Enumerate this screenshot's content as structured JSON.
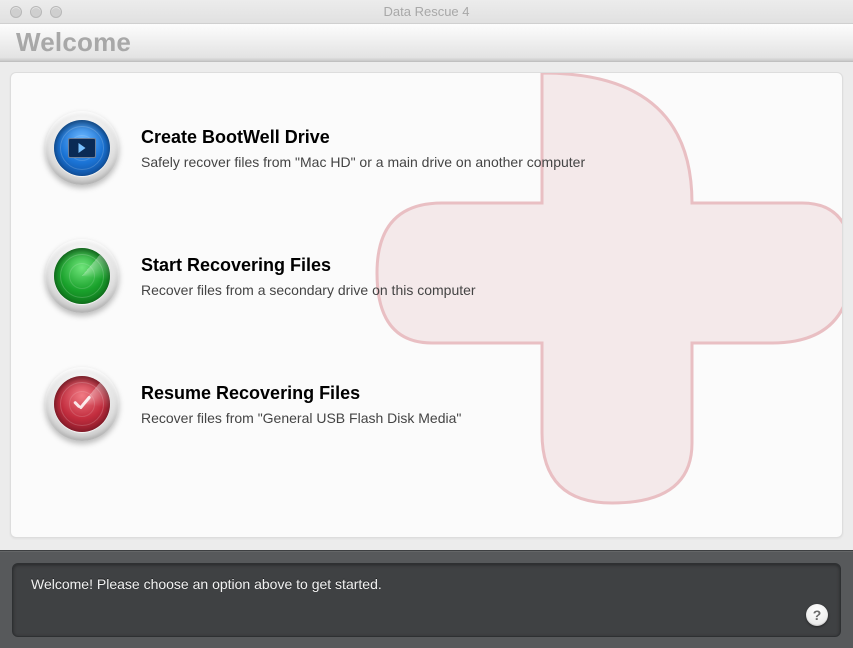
{
  "window": {
    "title": "Data Rescue 4"
  },
  "banner": {
    "title": "Welcome"
  },
  "options": [
    {
      "id": "bootwell",
      "title": "Create BootWell Drive",
      "subtitle": "Safely recover files from \"Mac HD\" or a main drive on another computer",
      "orb_color": "blue",
      "icon": "monitor-play-icon"
    },
    {
      "id": "start",
      "title": "Start Recovering Files",
      "subtitle": "Recover files from a secondary drive on this computer",
      "orb_color": "green",
      "icon": "radar-icon"
    },
    {
      "id": "resume",
      "title": "Resume Recovering Files",
      "subtitle": "Recover files from \"General USB Flash Disk Media\"",
      "orb_color": "red",
      "icon": "radar-check-icon"
    }
  ],
  "footer": {
    "message": "Welcome! Please choose an option above to get started.",
    "help_label": "?"
  },
  "colors": {
    "accent_cross": "#e3b6b9"
  }
}
